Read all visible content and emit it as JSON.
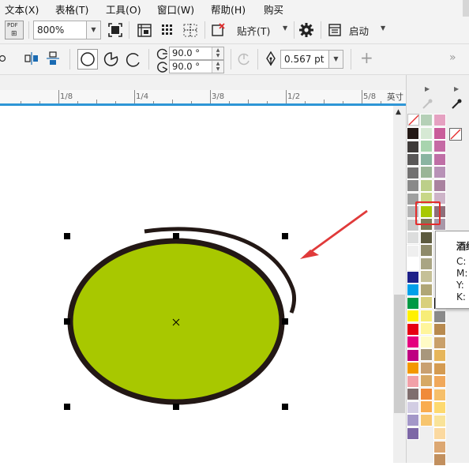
{
  "menu": {
    "items": [
      {
        "label": "文本(X)"
      },
      {
        "label": "表格(T)"
      },
      {
        "label": "工具(O)"
      },
      {
        "label": "窗口(W)"
      },
      {
        "label": "帮助(H)"
      },
      {
        "label": "购买"
      }
    ]
  },
  "toolbar1": {
    "pdf_label": "PDF",
    "zoom_value": "800%",
    "snap_label": "贴齐(T)",
    "launch_label": "启动"
  },
  "toolbar2": {
    "angle_start": "90.0 °",
    "angle_end": "90.0 °",
    "outline_width": "0.567 pt"
  },
  "ruler": {
    "labels": [
      "1/8",
      "1/4",
      "3/8",
      "1/2",
      "5/8"
    ],
    "unit": "英寸"
  },
  "colors": {
    "ellipse_fill": "#a8c800",
    "outline": "#231815",
    "arrow": "#e03a3a",
    "highlight_box": "#e52c2c",
    "selection_marker": "#2e96d6"
  },
  "palette": {
    "col1": [
      "#231815",
      "#3e3a39",
      "#595757",
      "#727171",
      "#898989",
      "#9fa0a0",
      "#b5b5b6",
      "#c9caca",
      "#dcdddd",
      "#efefef",
      "#ffffff",
      "#1d2088",
      "#00a0e9",
      "#009944",
      "#fff100",
      "#e60012",
      "#e4007f",
      "#be0081",
      "#f39800",
      "#f1a0a8",
      "#7f6e6e",
      "#d2cde3",
      "#a397c8",
      "#7d67a6"
    ],
    "col2": [
      "#b5d0b7",
      "#d6e9d4",
      "#a8d4ae",
      "#8ab4a1",
      "#9ab597",
      "#bccf89",
      "#c8d788",
      "#a8c800",
      "#7d7a59",
      "#5c5a3f",
      "#8d8a6a",
      "#a9a584",
      "#c5c097",
      "#b0a676",
      "#d8cf7c",
      "#f7ed78",
      "#fff59c",
      "#fffbc6",
      "#a8977c",
      "#c9a071",
      "#d6a865",
      "#f08a3a",
      "#f9ac50",
      "#f7c56e"
    ],
    "col3": [
      "#e5a1c1",
      "#c95d9a",
      "#c56aa4",
      "#bf6fa6",
      "#b892b7",
      "#a9829f",
      "#cdb4c8",
      "#8e6e7a",
      "#a797a8"
    ],
    "col3_extra": [
      "#000000",
      "#8a8a8a",
      "#b88a4f",
      "#c9a06a",
      "#e6b65b",
      "#d49b52",
      "#f0a85b",
      "#f6bf6a",
      "#fdd96f",
      "#f9e399",
      "#fbd9a0",
      "#dca772",
      "#c2905e"
    ]
  },
  "tooltip": {
    "name": "酒绿",
    "c_label": "C:",
    "m_label": "M:",
    "y_label": "Y:",
    "k_label": "K:"
  }
}
